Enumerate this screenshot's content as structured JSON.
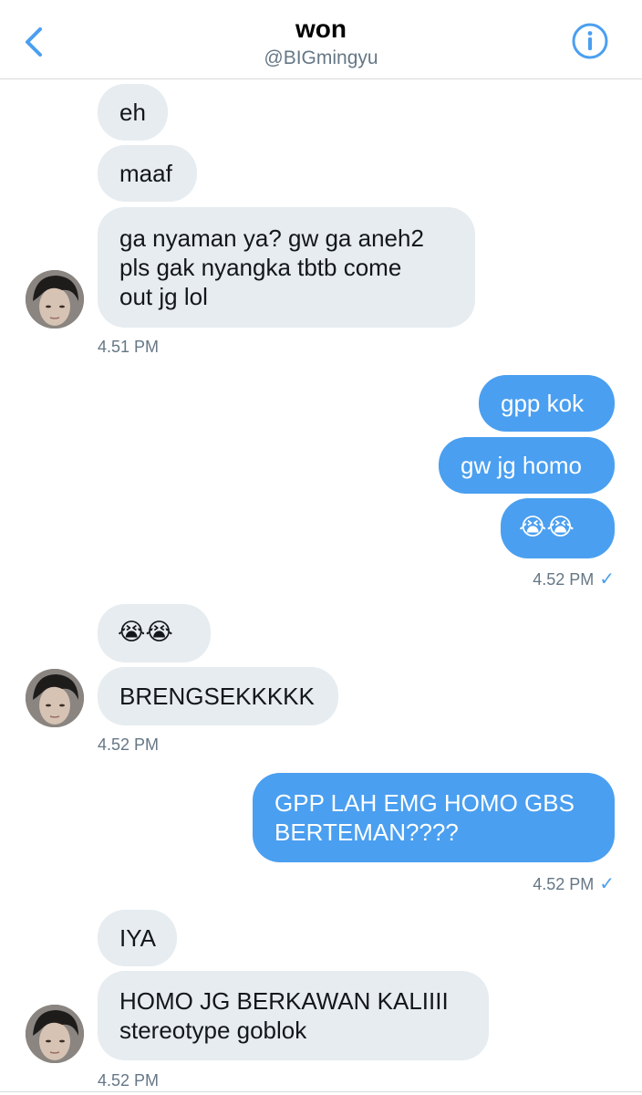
{
  "header": {
    "title": "won",
    "handle": "@BIGmingyu",
    "back_icon": "chevron-left-icon",
    "info_icon": "info-circle-icon",
    "accent": "#4a9ff0"
  },
  "colors": {
    "incoming_bubble": "#e6ecf0",
    "outgoing_bubble": "#4a9ff0",
    "timestamp": "#657786"
  },
  "messages": [
    {
      "direction": "incoming",
      "text": "eh"
    },
    {
      "direction": "incoming",
      "text": "maaf"
    },
    {
      "direction": "incoming",
      "text": "ga nyaman ya? gw ga aneh2\npls gak nyangka tbtb come\nout jg lol",
      "timestamp": "4.51 PM"
    },
    {
      "direction": "outgoing",
      "text": "gpp kok"
    },
    {
      "direction": "outgoing",
      "text": "gw jg homo"
    },
    {
      "direction": "outgoing",
      "text": "😭😭",
      "timestamp": "4.52 PM",
      "status": "✓"
    },
    {
      "direction": "incoming",
      "text": "😭😭"
    },
    {
      "direction": "incoming",
      "text": "BRENGSEKKKKK",
      "timestamp": "4.52 PM"
    },
    {
      "direction": "outgoing",
      "text": "GPP LAH EMG HOMO GBS\nBERTEMAN????",
      "timestamp": "4.52 PM",
      "status": "✓"
    },
    {
      "direction": "incoming",
      "text": "IYA"
    },
    {
      "direction": "incoming",
      "text": "HOMO JG BERKAWAN KALIIII\nstereotype goblok",
      "timestamp": "4.52 PM"
    }
  ]
}
